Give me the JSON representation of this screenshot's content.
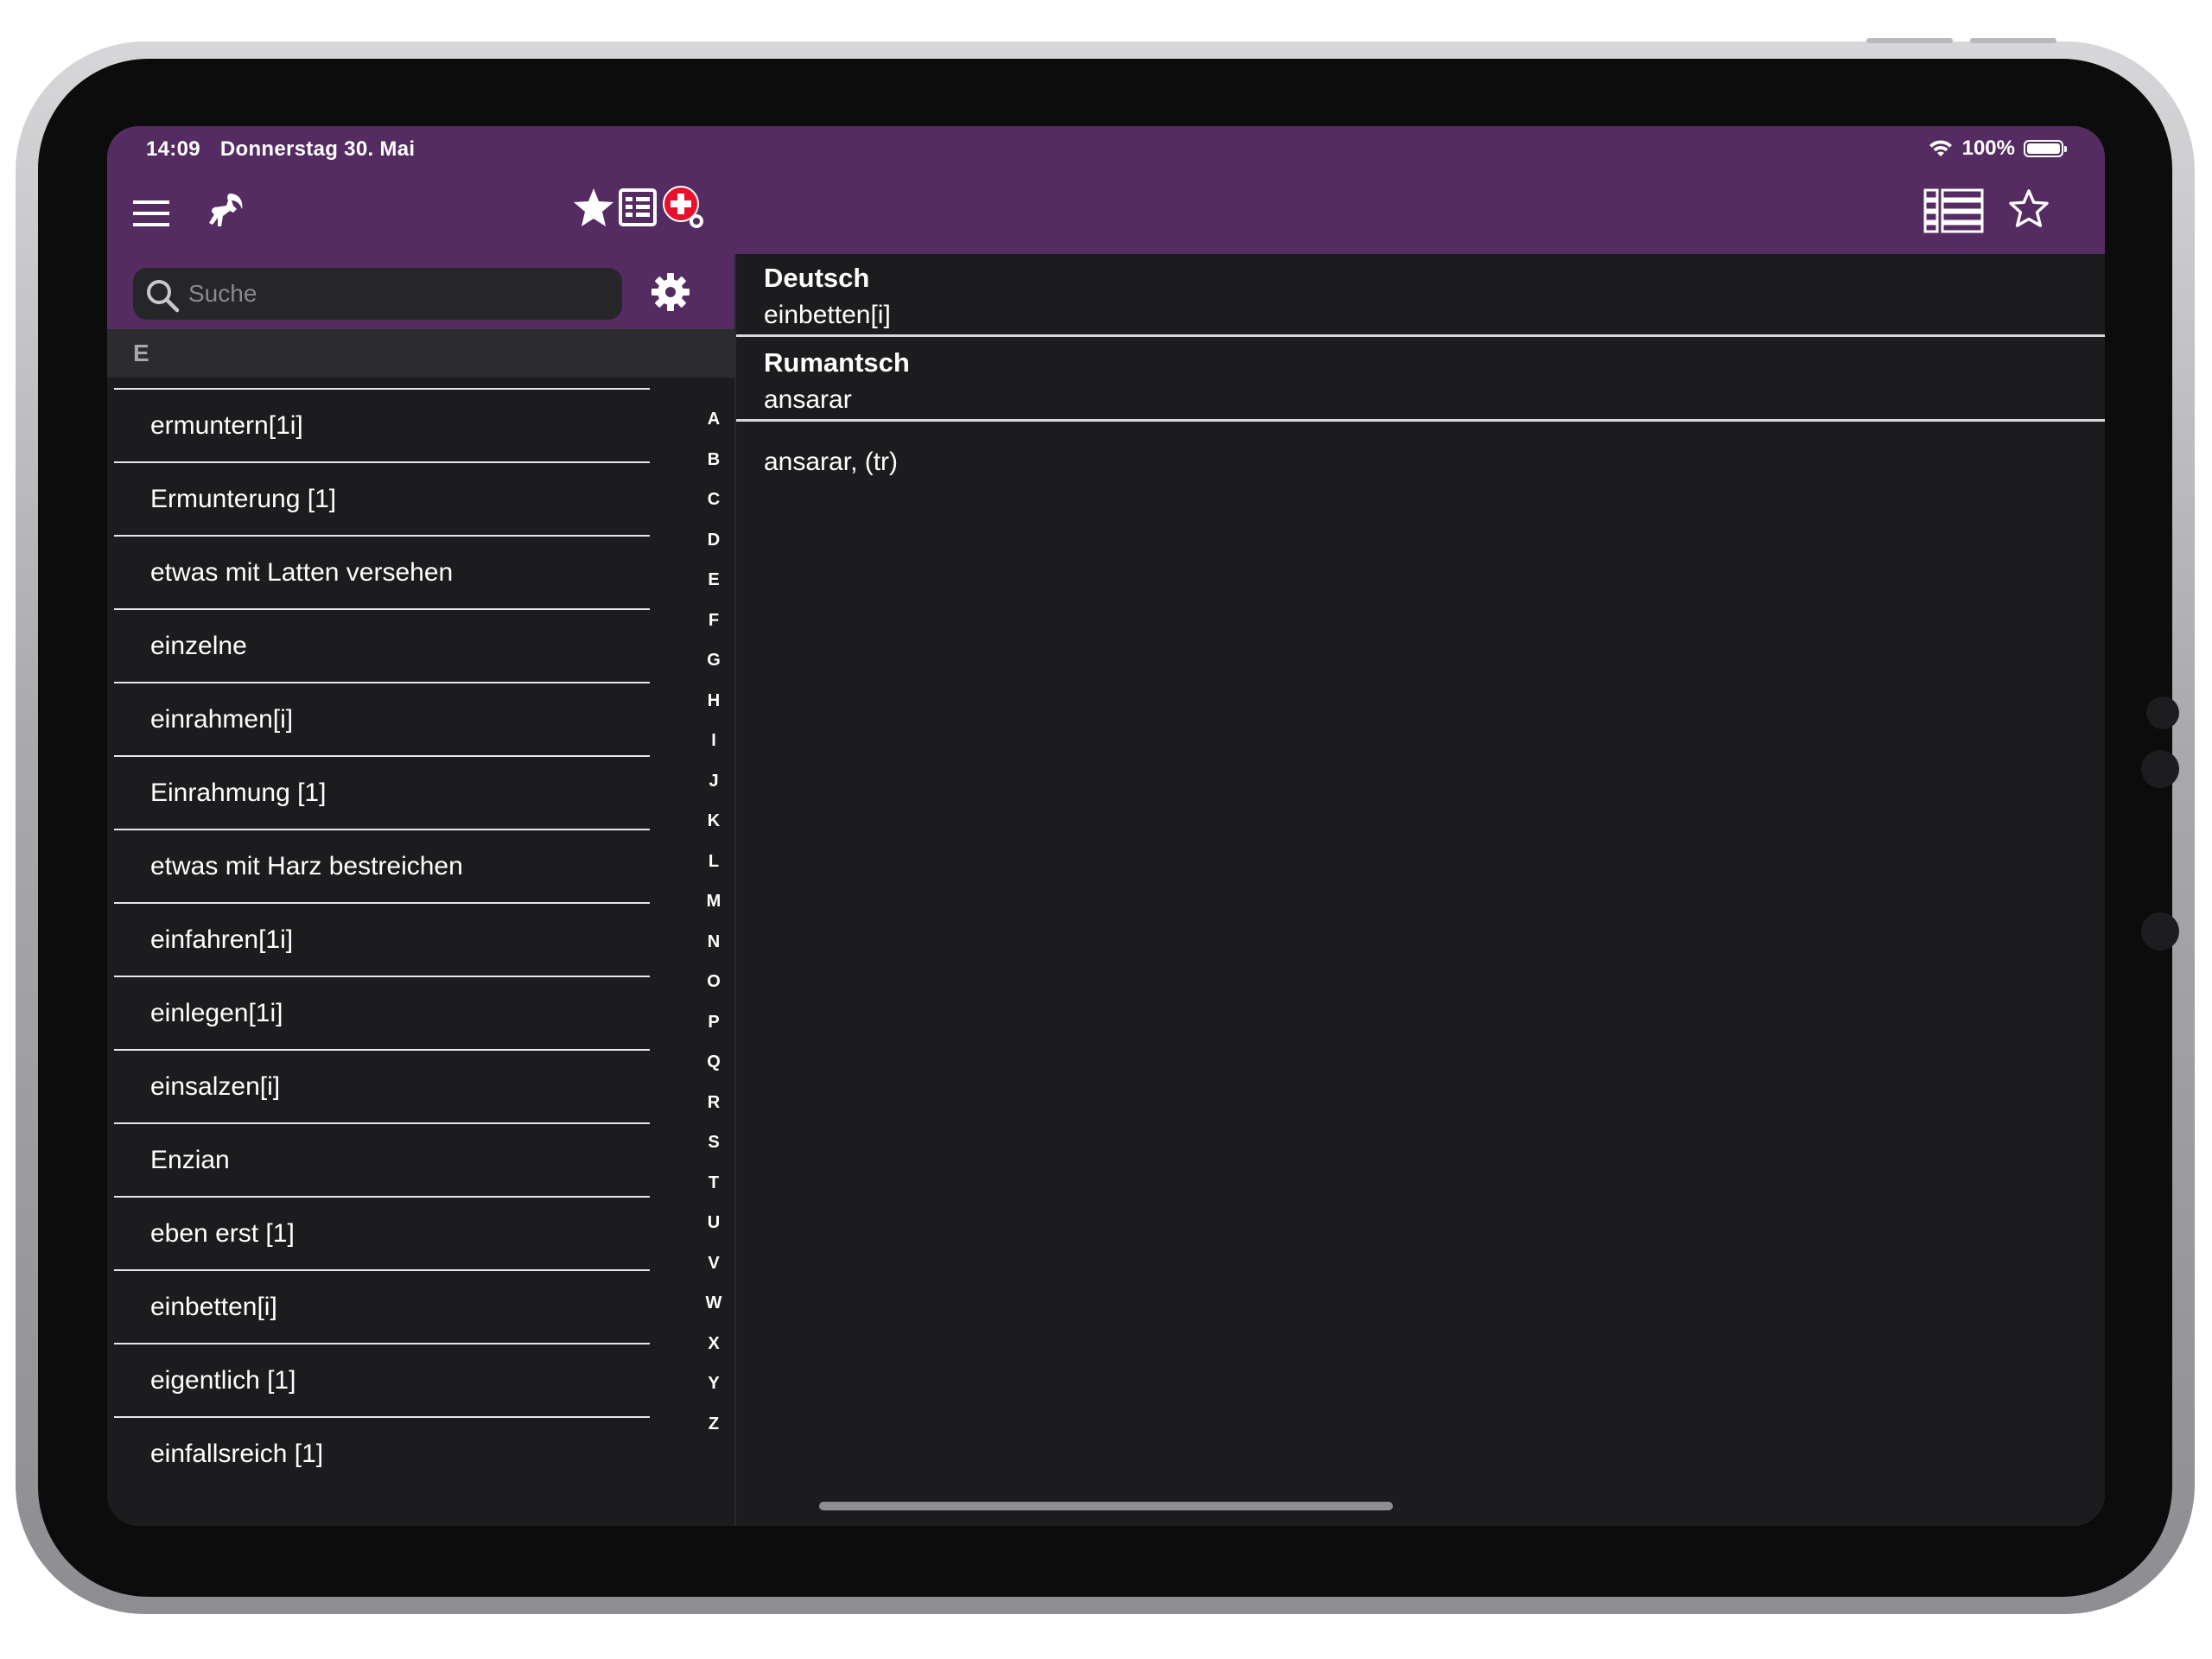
{
  "status_bar": {
    "time": "14:09",
    "date": "Donnerstag 30. Mai",
    "battery": "100%"
  },
  "nav": {
    "menu_icon": "hamburger-menu-icon",
    "logo_icon": "ibex-logo-icon",
    "favorites_icon": "star-filled-icon",
    "list_icon": "list-settings-icon",
    "swiss_flag_icon": "swiss-flag-icon",
    "table_view_icon": "table-list-icon",
    "favorite_toggle_icon": "star-outline-icon"
  },
  "search": {
    "placeholder": "Suche",
    "value": ""
  },
  "section_letter": "E",
  "words": [
    "ermuntern[1i]",
    "Ermunterung [1]",
    "etwas mit Latten versehen",
    "einzelne",
    "einrahmen[i]",
    "Einrahmung [1]",
    "etwas mit Harz bestreichen",
    "einfahren[1i]",
    "einlegen[1i]",
    "einsalzen[i]",
    "Enzian",
    "eben erst [1]",
    "einbetten[i]",
    "eigentlich [1]",
    "einfallsreich [1]"
  ],
  "alphabet": [
    "A",
    "B",
    "C",
    "D",
    "E",
    "F",
    "G",
    "H",
    "I",
    "J",
    "K",
    "L",
    "M",
    "N",
    "O",
    "P",
    "Q",
    "R",
    "S",
    "T",
    "U",
    "V",
    "W",
    "X",
    "Y",
    "Z"
  ],
  "detail": {
    "source_lang": "Deutsch",
    "source_word": "einbetten[i]",
    "target_lang": "Rumantsch",
    "target_word": "ansarar",
    "definition": "ansarar, (tr)"
  },
  "colors": {
    "accent_purple": "#552c61",
    "background": "#1c1c1e",
    "section_header": "#2c2c2e"
  }
}
